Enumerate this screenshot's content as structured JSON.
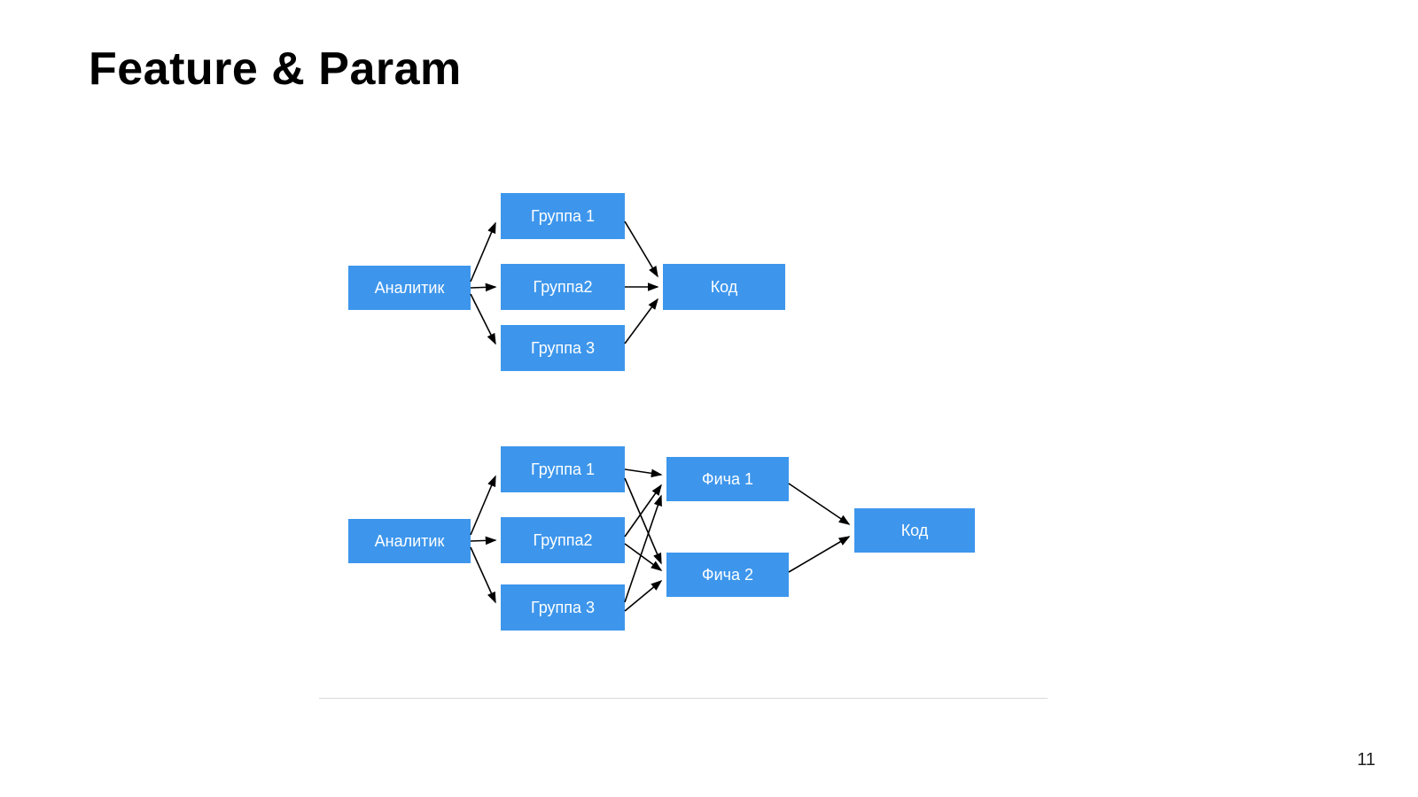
{
  "title": "Feature & Param",
  "page_number": "11",
  "colors": {
    "node_bg": "#3D96EC",
    "node_fg": "#ffffff",
    "arrow": "#000000"
  },
  "diagram1": {
    "analyst": "Аналитик",
    "group1": "Группа 1",
    "group2": "Группа2",
    "group3": "Группа 3",
    "code": "Код"
  },
  "diagram2": {
    "analyst": "Аналитик",
    "group1": "Группа 1",
    "group2": "Группа2",
    "group3": "Группа 3",
    "feature1": "Фича 1",
    "feature2": "Фича 2",
    "code": "Код"
  }
}
